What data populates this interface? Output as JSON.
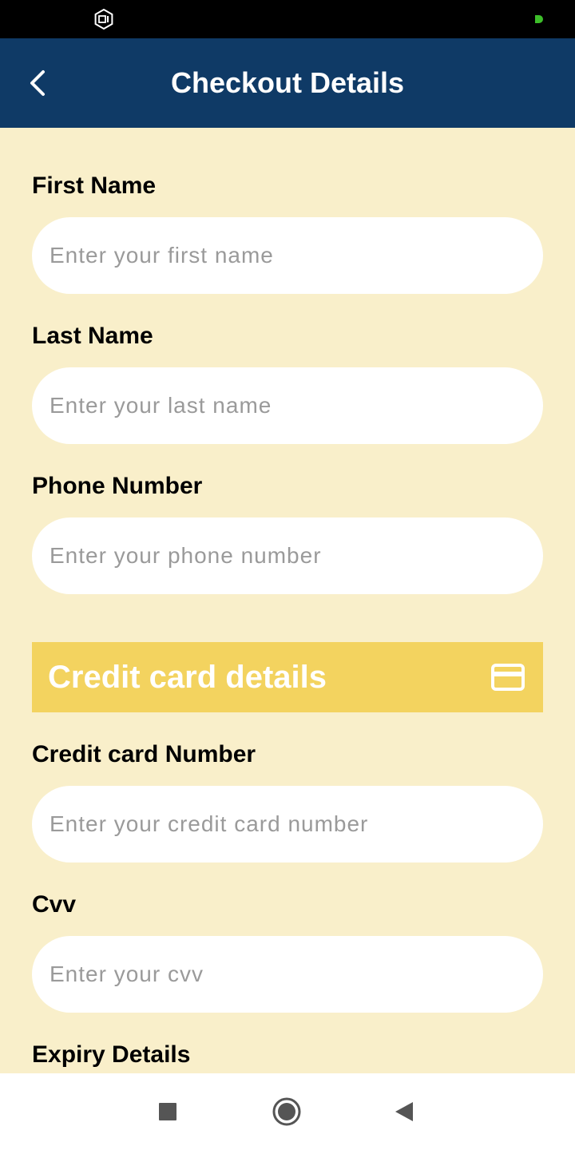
{
  "app_bar": {
    "title": "Checkout Details",
    "back_icon": "chevron-left-icon",
    "background": "#0F3A66"
  },
  "status_bar": {
    "left_icon": "mi-logo-icon",
    "right_icon": "green-dot-icon",
    "dot_color": "#3DBE2A"
  },
  "form": {
    "first_name": {
      "label": "First Name",
      "placeholder": "Enter your first name",
      "value": ""
    },
    "last_name": {
      "label": "Last Name",
      "placeholder": "Enter your last name",
      "value": ""
    },
    "phone_number": {
      "label": "Phone Number",
      "placeholder": "Enter your phone number",
      "value": ""
    }
  },
  "credit_card_section": {
    "title": "Credit card details",
    "icon": "credit-card-icon",
    "background": "#F3D35F",
    "card_number": {
      "label": "Credit card Number",
      "placeholder": "Enter your credit card number",
      "value": ""
    },
    "cvv": {
      "label": "Cvv",
      "placeholder": "Enter your cvv",
      "value": ""
    },
    "expiry_label": "Expiry Details"
  },
  "nav_bar": {
    "recents_icon": "square-icon",
    "home_icon": "circle-icon",
    "back_icon": "triangle-back-icon"
  },
  "colors": {
    "page_background": "#F9EFCA",
    "input_background": "#FFFFFF",
    "placeholder": "#9A9A9A"
  }
}
